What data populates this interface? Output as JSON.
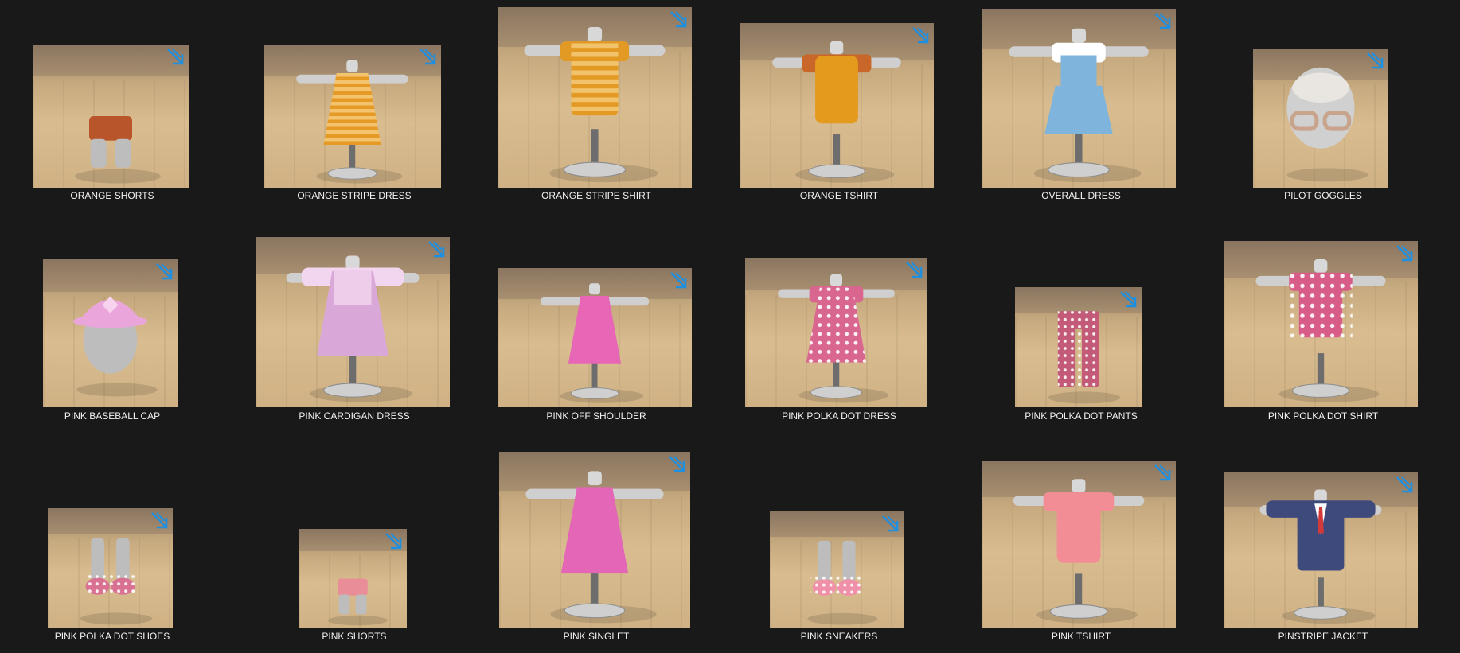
{
  "window": {
    "title": ""
  },
  "colors": {
    "background": "#191919",
    "label_text": "#f2f2f2",
    "shortcut_arrow": "#1f8fe0"
  },
  "items": [
    {
      "label": "ORANGE SHORTS",
      "kind": "shorts",
      "main": "#b9552b",
      "accent": "#b9552b",
      "icon": "shortcut-arrow-icon"
    },
    {
      "label": "ORANGE STRIPE DRESS",
      "kind": "dress",
      "main": "#e49a24",
      "accent": "#f4c35a",
      "icon": "shortcut-arrow-icon"
    },
    {
      "label": "ORANGE STRIPE SHIRT",
      "kind": "shirt",
      "main": "#e39a24",
      "accent": "#f0c25c",
      "icon": "shortcut-arrow-icon"
    },
    {
      "label": "ORANGE TSHIRT",
      "kind": "tshirt",
      "main": "#e49a1d",
      "accent": "#c9672a",
      "icon": "shortcut-arrow-icon"
    },
    {
      "label": "OVERALL DRESS",
      "kind": "overall",
      "main": "#7fb4dc",
      "accent": "#ffffff",
      "icon": "shortcut-arrow-icon"
    },
    {
      "label": "PILOT GOGGLES",
      "kind": "goggles",
      "main": "#c9a48c",
      "accent": "#e9e6e2",
      "icon": "shortcut-arrow-icon"
    },
    {
      "label": "PINK BASEBALL CAP",
      "kind": "cap",
      "main": "#eaa6db",
      "accent": "#f8d3ef",
      "icon": "shortcut-arrow-icon"
    },
    {
      "label": "PINK CARDIGAN DRESS",
      "kind": "cardigan",
      "main": "#d9a8d9",
      "accent": "#f2d6ef",
      "icon": "shortcut-arrow-icon"
    },
    {
      "label": "PINK OFF SHOULDER",
      "kind": "offshoulder",
      "main": "#e866b6",
      "accent": "#e866b6",
      "icon": "shortcut-arrow-icon"
    },
    {
      "label": "PINK POLKA DOT DRESS",
      "kind": "dotdress",
      "main": "#d9668f",
      "accent": "#ffffff",
      "icon": "shortcut-arrow-icon"
    },
    {
      "label": "PINK POLKA DOT PANTS",
      "kind": "dotpants",
      "main": "#c25a78",
      "accent": "#ffffff",
      "icon": "shortcut-arrow-icon"
    },
    {
      "label": "PINK POLKA DOT SHIRT",
      "kind": "dotshirt",
      "main": "#d75c88",
      "accent": "#ffffff",
      "icon": "shortcut-arrow-icon"
    },
    {
      "label": "PINK POLKA DOT SHOES",
      "kind": "shoes",
      "main": "#d97192",
      "accent": "#ffffff",
      "icon": "shortcut-arrow-icon"
    },
    {
      "label": "PINK SHORTS",
      "kind": "shorts",
      "main": "#e98d98",
      "accent": "#e98d98",
      "icon": "shortcut-arrow-icon"
    },
    {
      "label": "PINK SINGLET",
      "kind": "singlet",
      "main": "#e466b6",
      "accent": "#e466b6",
      "icon": "shortcut-arrow-icon"
    },
    {
      "label": "PINK SNEAKERS",
      "kind": "sneakers",
      "main": "#f090a8",
      "accent": "#ffffff",
      "icon": "shortcut-arrow-icon"
    },
    {
      "label": "PINK TSHIRT",
      "kind": "tshirt",
      "main": "#f28c95",
      "accent": "#f28c95",
      "icon": "shortcut-arrow-icon"
    },
    {
      "label": "PINSTRIPE JACKET",
      "kind": "jacket",
      "main": "#3f4a7c",
      "accent": "#d23a3a",
      "icon": "shortcut-arrow-icon"
    }
  ]
}
